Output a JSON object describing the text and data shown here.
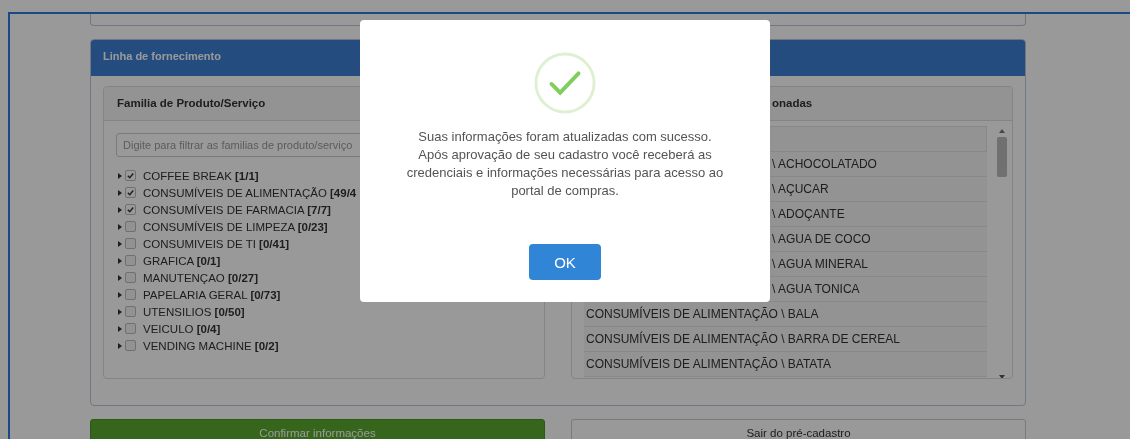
{
  "panel": {
    "title": "Linha de fornecimento"
  },
  "families": {
    "title": "Familia de Produto/Serviço",
    "filter_placeholder": "Digite para filtrar as familias de produto/serviço",
    "items": [
      {
        "label": "COFFEE BREAK **[1/1]**",
        "checked": true
      },
      {
        "label": "CONSUMÍVEIS DE ALIMENTAÇÃO **[49/4**",
        "checked": true
      },
      {
        "label": "CONSUMÍVEIS DE FARMACIA **[7/7]**",
        "checked": true
      },
      {
        "label": "CONSUMÍVEIS DE LIMPEZA **[0/23]**",
        "checked": false
      },
      {
        "label": "CONSUMIVEIS DE TI **[0/41]**",
        "checked": false
      },
      {
        "label": "GRAFICA **[0/1]**",
        "checked": false
      },
      {
        "label": "MANUTENÇAO **[0/27]**",
        "checked": false
      },
      {
        "label": "PAPELARIA GERAL **[0/73]**",
        "checked": false
      },
      {
        "label": "UTENSILIOS **[0/50]**",
        "checked": false
      },
      {
        "label": "VEICULO **[0/4]**",
        "checked": false
      },
      {
        "label": "VENDING MACHINE **[0/2]**",
        "checked": false
      }
    ]
  },
  "selected": {
    "title": "onadas",
    "rows": [
      {
        "kind": "partial",
        "text": "\\ ACHOCOLATADO"
      },
      {
        "kind": "partial",
        "text": "\\ AÇUCAR"
      },
      {
        "kind": "partial",
        "text": "\\ ADOÇANTE"
      },
      {
        "kind": "partial",
        "text": "\\ AGUA DE COCO"
      },
      {
        "kind": "partial",
        "text": "\\ AGUA MINERAL"
      },
      {
        "kind": "partial",
        "text": "\\ AGUA TONICA"
      },
      {
        "kind": "full",
        "text": "CONSUMÍVEIS DE ALIMENTAÇÃO \\ BALA"
      },
      {
        "kind": "full",
        "text": "CONSUMÍVEIS DE ALIMENTAÇÃO \\ BARRA DE CEREAL"
      },
      {
        "kind": "full",
        "text": "CONSUMÍVEIS DE ALIMENTAÇÃO \\ BATATA"
      }
    ]
  },
  "buttons": {
    "confirm": "Confirmar informações",
    "exit": "Sair do pré-cadastro"
  },
  "dialog": {
    "message": "Suas informações foram atualizadas com sucesso. Após aprovação de seu cadastro você receberá as credenciais e informações necessárias para acesso ao portal de compras.",
    "ok": "OK"
  }
}
